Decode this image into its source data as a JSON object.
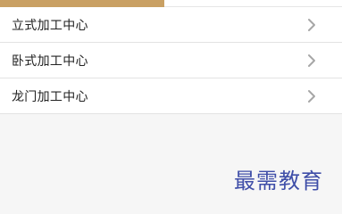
{
  "menu": {
    "items": [
      {
        "label": "立式加工中心",
        "icon": "chevron-right-icon"
      },
      {
        "label": "卧式加工中心",
        "icon": "chevron-right-icon"
      },
      {
        "label": "龙门加工中心",
        "icon": "chevron-right-icon"
      }
    ]
  },
  "colors": {
    "accent": "#c9a063",
    "chevron": "#a6a6a6",
    "divider": "#e3e3e3",
    "background": "#f6f6f6",
    "watermark": "#3f4ea8"
  },
  "watermark": {
    "text": "最需教育"
  }
}
